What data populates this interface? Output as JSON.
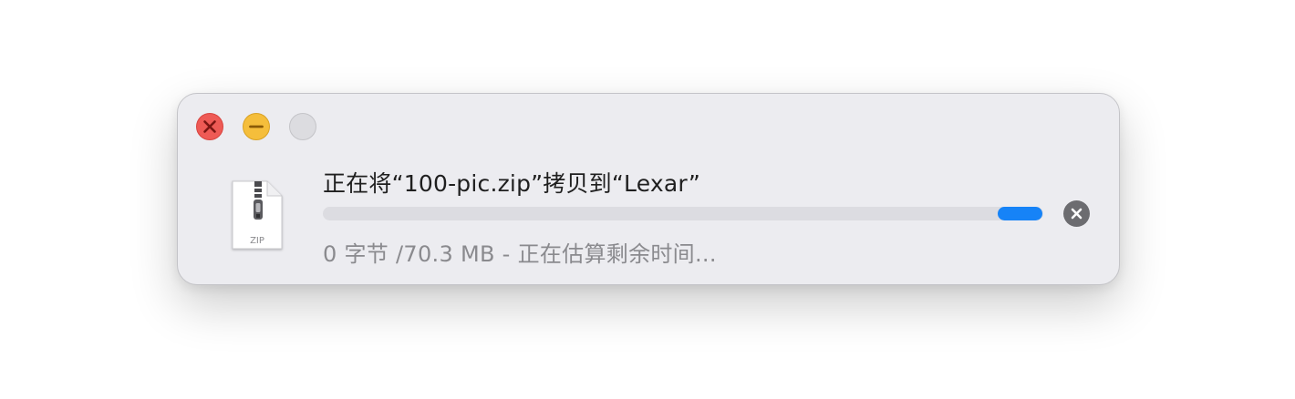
{
  "window": {
    "buttons": {
      "close_icon": "close-icon",
      "minimize_icon": "minimize-icon",
      "zoom_icon": "zoom-icon"
    }
  },
  "copy": {
    "file_type_label": "ZIP",
    "title": "正在将“100-pic.zip”拷贝到“Lexar”",
    "progress_fraction": 0,
    "status": "0 字节 /70.3 MB - 正在估算剩余时间...",
    "stop_icon": "stop-x-icon"
  },
  "colors": {
    "close": "#ee5a55",
    "minimize": "#f5be3b",
    "zoom_inactive": "#dcdce0",
    "progress_accent": "#1683f7",
    "progress_track": "#dcdce1",
    "stop_button": "#6c6c70"
  }
}
